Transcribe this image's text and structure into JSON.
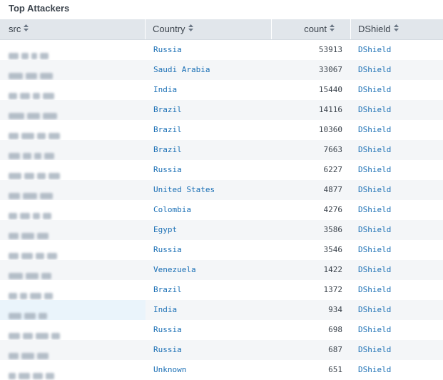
{
  "panel": {
    "title": "Top Attackers"
  },
  "columns": [
    {
      "label": "src"
    },
    {
      "label": "Country"
    },
    {
      "label": "count"
    },
    {
      "label": "DShield"
    }
  ],
  "icons": {
    "sort": "sort-both-icon"
  },
  "colors": {
    "header_bg": "#e1e6eb",
    "row_alt_bg": "#f4f6f8",
    "link": "#1a6fb5",
    "text": "#3c444d"
  },
  "rows": [
    {
      "src": "[redacted]",
      "country": "Russia",
      "count": "53913",
      "dshield": "DShield"
    },
    {
      "src": "[redacted]",
      "country": "Saudi Arabia",
      "count": "33067",
      "dshield": "DShield"
    },
    {
      "src": "[redacted]",
      "country": "India",
      "count": "15440",
      "dshield": "DShield"
    },
    {
      "src": "[redacted]",
      "country": "Brazil",
      "count": "14116",
      "dshield": "DShield"
    },
    {
      "src": "[redacted]",
      "country": "Brazil",
      "count": "10360",
      "dshield": "DShield"
    },
    {
      "src": "[redacted]",
      "country": "Brazil",
      "count": "7663",
      "dshield": "DShield"
    },
    {
      "src": "[redacted]",
      "country": "Russia",
      "count": "6227",
      "dshield": "DShield"
    },
    {
      "src": "[redacted]",
      "country": "United States",
      "count": "4877",
      "dshield": "DShield"
    },
    {
      "src": "[redacted]",
      "country": "Colombia",
      "count": "4276",
      "dshield": "DShield"
    },
    {
      "src": "[redacted]",
      "country": "Egypt",
      "count": "3586",
      "dshield": "DShield"
    },
    {
      "src": "[redacted]",
      "country": "Russia",
      "count": "3546",
      "dshield": "DShield"
    },
    {
      "src": "[redacted]",
      "country": "Venezuela",
      "count": "1422",
      "dshield": "DShield"
    },
    {
      "src": "[redacted]",
      "country": "Brazil",
      "count": "1372",
      "dshield": "DShield"
    },
    {
      "src": "[redacted]",
      "country": "India",
      "count": "934",
      "dshield": "DShield"
    },
    {
      "src": "[redacted]",
      "country": "Russia",
      "count": "698",
      "dshield": "DShield"
    },
    {
      "src": "[redacted]",
      "country": "Russia",
      "count": "687",
      "dshield": "DShield"
    },
    {
      "src": "[redacted]",
      "country": "Unknown",
      "count": "651",
      "dshield": "DShield"
    }
  ]
}
